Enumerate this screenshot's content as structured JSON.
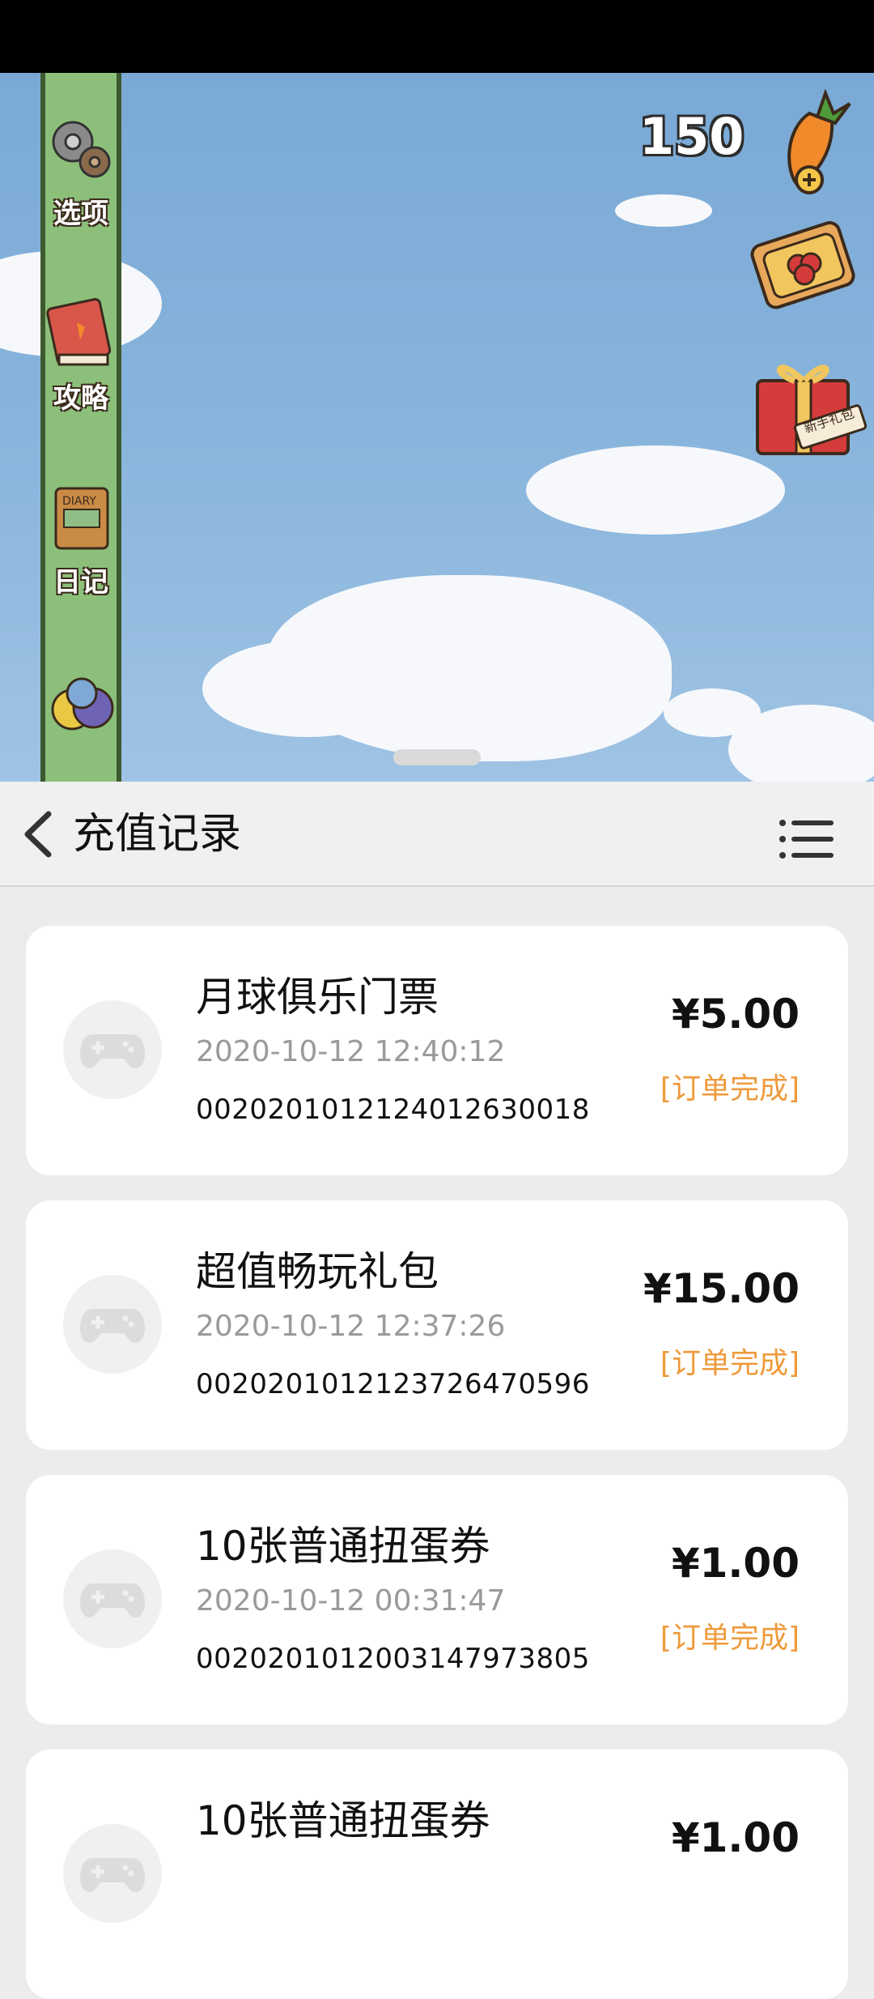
{
  "game": {
    "coins": "150",
    "sidebar": [
      {
        "label": "选项",
        "icon": "gears-icon"
      },
      {
        "label": "攻略",
        "icon": "guide-book-icon"
      },
      {
        "label": "日记",
        "icon": "diary-icon"
      },
      {
        "label": "",
        "icon": "capsule-balls-icon"
      }
    ],
    "gift_pack_label": "新手礼包",
    "diary_book_text": "DIARY"
  },
  "header": {
    "title": "充值记录",
    "back_icon": "chevron-left-icon",
    "menu_icon": "list-menu-icon"
  },
  "records": [
    {
      "name": "月球俱乐门票",
      "time": "2020-10-12 12:40:12",
      "order": "002020101212401263001​8",
      "price": "¥5.00",
      "status": "[订单完成]"
    },
    {
      "name": "超值畅玩礼包",
      "time": "2020-10-12 12:37:26",
      "order": "0020201012123726470596",
      "price": "¥15.00",
      "status": "[订单完成]"
    },
    {
      "name": "10张普通扭蛋券",
      "time": "2020-10-12 00:31:47",
      "order": "0020201012003147973805",
      "price": "¥1.00",
      "status": "[订单完成]"
    },
    {
      "name": "10张普通扭蛋券",
      "time": "",
      "order": "",
      "price": "¥1.00",
      "status": ""
    }
  ],
  "colors": {
    "status": "#ee9a3b",
    "time": "#9a9a9a",
    "sky": "#86b3db"
  }
}
